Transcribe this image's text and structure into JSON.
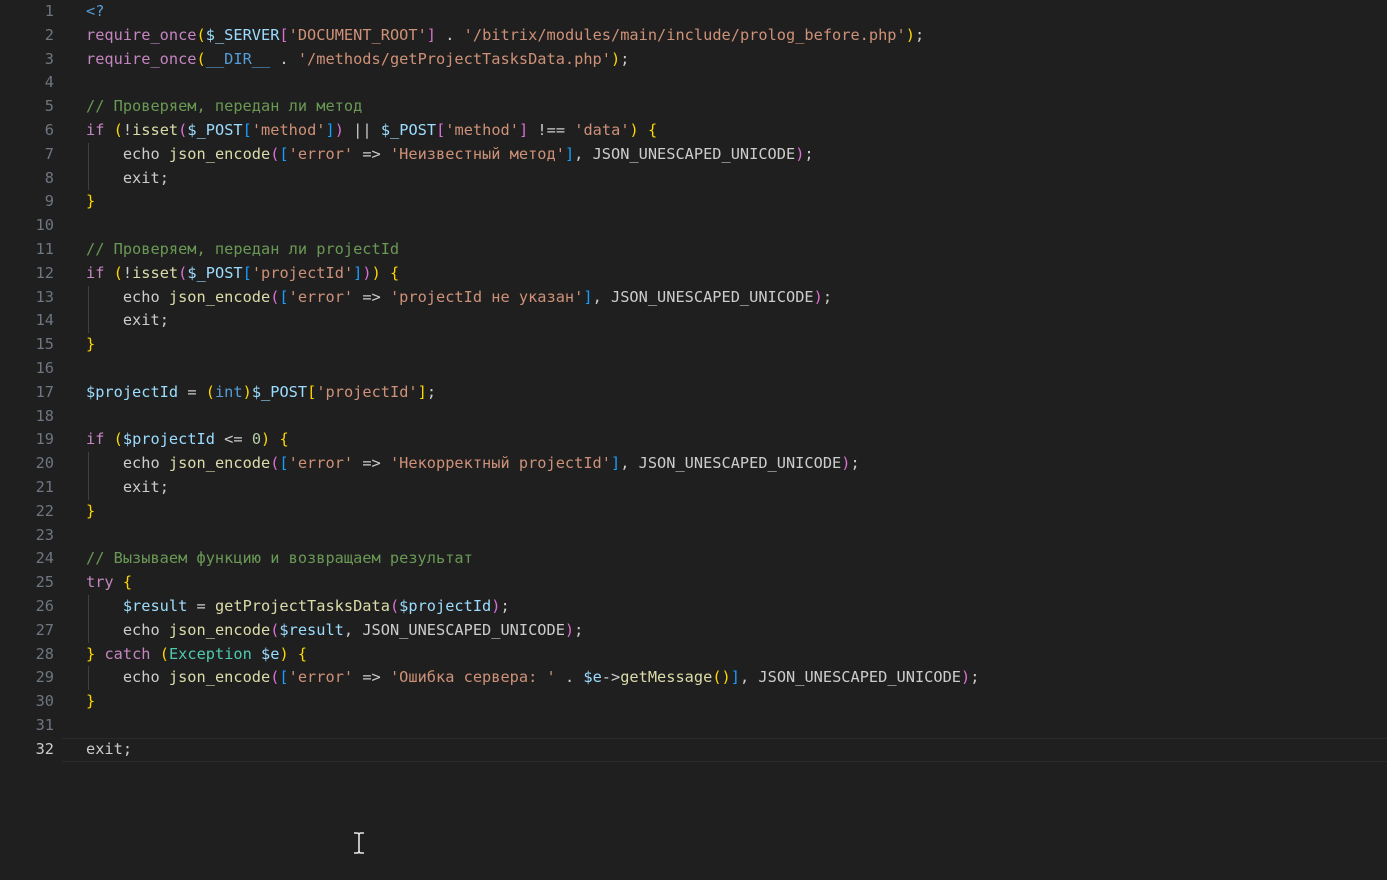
{
  "editor": {
    "language": "php",
    "current_line": 32,
    "colors": {
      "background": "#1f1f1f",
      "line_number": "#6e7681",
      "line_number_active": "#cccccc",
      "keyword": "#569cd6",
      "control": "#c586c0",
      "function": "#dcdcaa",
      "variable": "#9cdcfe",
      "string": "#ce9178",
      "comment": "#6a9955",
      "constant": "#4fc1ff",
      "type": "#4ec9b0",
      "number": "#b5cea8",
      "bracket1": "#ffd700",
      "bracket2": "#da70d6",
      "bracket3": "#179fff",
      "plain": "#cccccc"
    },
    "lines": [
      {
        "n": "1",
        "t": [
          [
            "<?",
            "keyword"
          ]
        ]
      },
      {
        "n": "2",
        "t": [
          [
            "require_once",
            "control"
          ],
          [
            "(",
            "bracket1"
          ],
          [
            "$_SERVER",
            "variable"
          ],
          [
            "[",
            "bracket2"
          ],
          [
            "'DOCUMENT_ROOT'",
            "string"
          ],
          [
            "]",
            "bracket2"
          ],
          [
            " . ",
            "plain"
          ],
          [
            "'/bitrix/modules/main/include/prolog_before.php'",
            "string"
          ],
          [
            ")",
            "bracket1"
          ],
          [
            ";",
            "plain"
          ]
        ]
      },
      {
        "n": "3",
        "t": [
          [
            "require_once",
            "control"
          ],
          [
            "(",
            "bracket1"
          ],
          [
            "__DIR__",
            "keyword"
          ],
          [
            " . ",
            "plain"
          ],
          [
            "'/methods/getProjectTasksData.php'",
            "string"
          ],
          [
            ")",
            "bracket1"
          ],
          [
            ";",
            "plain"
          ]
        ]
      },
      {
        "n": "4",
        "t": []
      },
      {
        "n": "5",
        "t": [
          [
            "// Проверяем, передан ли метод",
            "comment"
          ]
        ]
      },
      {
        "n": "6",
        "t": [
          [
            "if",
            "control"
          ],
          [
            " ",
            "plain"
          ],
          [
            "(",
            "bracket1"
          ],
          [
            "!",
            "plain"
          ],
          [
            "isset",
            "function"
          ],
          [
            "(",
            "bracket2"
          ],
          [
            "$_POST",
            "variable"
          ],
          [
            "[",
            "bracket3"
          ],
          [
            "'method'",
            "string"
          ],
          [
            "]",
            "bracket3"
          ],
          [
            ")",
            "bracket2"
          ],
          [
            " || ",
            "plain"
          ],
          [
            "$_POST",
            "variable"
          ],
          [
            "[",
            "bracket2"
          ],
          [
            "'method'",
            "string"
          ],
          [
            "]",
            "bracket2"
          ],
          [
            " !== ",
            "plain"
          ],
          [
            "'data'",
            "string"
          ],
          [
            ")",
            "bracket1"
          ],
          [
            " ",
            "plain"
          ],
          [
            "{",
            "bracket1"
          ]
        ]
      },
      {
        "n": "7",
        "t": [
          [
            "    echo ",
            "plain"
          ],
          [
            "json_encode",
            "function"
          ],
          [
            "(",
            "bracket2"
          ],
          [
            "[",
            "bracket3"
          ],
          [
            "'error'",
            "string"
          ],
          [
            " => ",
            "plain"
          ],
          [
            "'Неизвестный метод'",
            "string"
          ],
          [
            "]",
            "bracket3"
          ],
          [
            ", ",
            "plain"
          ],
          [
            "JSON_UNESCAPED_UNICODE",
            "plain"
          ],
          [
            ")",
            "bracket2"
          ],
          [
            ";",
            "plain"
          ]
        ]
      },
      {
        "n": "8",
        "t": [
          [
            "    exit",
            "plain"
          ],
          [
            ";",
            "plain"
          ]
        ]
      },
      {
        "n": "9",
        "t": [
          [
            "}",
            "bracket1"
          ]
        ]
      },
      {
        "n": "10",
        "t": []
      },
      {
        "n": "11",
        "t": [
          [
            "// Проверяем, передан ли projectId",
            "comment"
          ]
        ]
      },
      {
        "n": "12",
        "t": [
          [
            "if",
            "control"
          ],
          [
            " ",
            "plain"
          ],
          [
            "(",
            "bracket1"
          ],
          [
            "!",
            "plain"
          ],
          [
            "isset",
            "function"
          ],
          [
            "(",
            "bracket2"
          ],
          [
            "$_POST",
            "variable"
          ],
          [
            "[",
            "bracket3"
          ],
          [
            "'projectId'",
            "string"
          ],
          [
            "]",
            "bracket3"
          ],
          [
            ")",
            "bracket2"
          ],
          [
            ")",
            "bracket1"
          ],
          [
            " ",
            "plain"
          ],
          [
            "{",
            "bracket1"
          ]
        ]
      },
      {
        "n": "13",
        "t": [
          [
            "    echo ",
            "plain"
          ],
          [
            "json_encode",
            "function"
          ],
          [
            "(",
            "bracket2"
          ],
          [
            "[",
            "bracket3"
          ],
          [
            "'error'",
            "string"
          ],
          [
            " => ",
            "plain"
          ],
          [
            "'projectId не указан'",
            "string"
          ],
          [
            "]",
            "bracket3"
          ],
          [
            ", ",
            "plain"
          ],
          [
            "JSON_UNESCAPED_UNICODE",
            "plain"
          ],
          [
            ")",
            "bracket2"
          ],
          [
            ";",
            "plain"
          ]
        ]
      },
      {
        "n": "14",
        "t": [
          [
            "    exit",
            "plain"
          ],
          [
            ";",
            "plain"
          ]
        ]
      },
      {
        "n": "15",
        "t": [
          [
            "}",
            "bracket1"
          ]
        ]
      },
      {
        "n": "16",
        "t": []
      },
      {
        "n": "17",
        "t": [
          [
            "$projectId",
            "variable"
          ],
          [
            " = ",
            "plain"
          ],
          [
            "(",
            "bracket1"
          ],
          [
            "int",
            "keyword"
          ],
          [
            ")",
            "bracket1"
          ],
          [
            "$_POST",
            "variable"
          ],
          [
            "[",
            "bracket1"
          ],
          [
            "'projectId'",
            "string"
          ],
          [
            "]",
            "bracket1"
          ],
          [
            ";",
            "plain"
          ]
        ]
      },
      {
        "n": "18",
        "t": []
      },
      {
        "n": "19",
        "t": [
          [
            "if",
            "control"
          ],
          [
            " ",
            "plain"
          ],
          [
            "(",
            "bracket1"
          ],
          [
            "$projectId",
            "variable"
          ],
          [
            " <= ",
            "plain"
          ],
          [
            "0",
            "number"
          ],
          [
            ")",
            "bracket1"
          ],
          [
            " ",
            "plain"
          ],
          [
            "{",
            "bracket1"
          ]
        ]
      },
      {
        "n": "20",
        "t": [
          [
            "    echo ",
            "plain"
          ],
          [
            "json_encode",
            "function"
          ],
          [
            "(",
            "bracket2"
          ],
          [
            "[",
            "bracket3"
          ],
          [
            "'error'",
            "string"
          ],
          [
            " => ",
            "plain"
          ],
          [
            "'Некорректный projectId'",
            "string"
          ],
          [
            "]",
            "bracket3"
          ],
          [
            ", ",
            "plain"
          ],
          [
            "JSON_UNESCAPED_UNICODE",
            "plain"
          ],
          [
            ")",
            "bracket2"
          ],
          [
            ";",
            "plain"
          ]
        ]
      },
      {
        "n": "21",
        "t": [
          [
            "    exit",
            "plain"
          ],
          [
            ";",
            "plain"
          ]
        ]
      },
      {
        "n": "22",
        "t": [
          [
            "}",
            "bracket1"
          ]
        ]
      },
      {
        "n": "23",
        "t": []
      },
      {
        "n": "24",
        "t": [
          [
            "// Вызываем функцию и возвращаем результат",
            "comment"
          ]
        ]
      },
      {
        "n": "25",
        "t": [
          [
            "try",
            "control"
          ],
          [
            " ",
            "plain"
          ],
          [
            "{",
            "bracket1"
          ]
        ]
      },
      {
        "n": "26",
        "t": [
          [
            "    ",
            "plain"
          ],
          [
            "$result",
            "variable"
          ],
          [
            " = ",
            "plain"
          ],
          [
            "getProjectTasksData",
            "function"
          ],
          [
            "(",
            "bracket2"
          ],
          [
            "$projectId",
            "variable"
          ],
          [
            ")",
            "bracket2"
          ],
          [
            ";",
            "plain"
          ]
        ]
      },
      {
        "n": "27",
        "t": [
          [
            "    echo ",
            "plain"
          ],
          [
            "json_encode",
            "function"
          ],
          [
            "(",
            "bracket2"
          ],
          [
            "$result",
            "variable"
          ],
          [
            ", ",
            "plain"
          ],
          [
            "JSON_UNESCAPED_UNICODE",
            "plain"
          ],
          [
            ")",
            "bracket2"
          ],
          [
            ";",
            "plain"
          ]
        ]
      },
      {
        "n": "28",
        "t": [
          [
            "}",
            "bracket1"
          ],
          [
            " ",
            "plain"
          ],
          [
            "catch",
            "control"
          ],
          [
            " ",
            "plain"
          ],
          [
            "(",
            "bracket1"
          ],
          [
            "Exception",
            "type"
          ],
          [
            " ",
            "plain"
          ],
          [
            "$e",
            "variable"
          ],
          [
            ")",
            "bracket1"
          ],
          [
            " ",
            "plain"
          ],
          [
            "{",
            "bracket1"
          ]
        ]
      },
      {
        "n": "29",
        "t": [
          [
            "    echo ",
            "plain"
          ],
          [
            "json_encode",
            "function"
          ],
          [
            "(",
            "bracket2"
          ],
          [
            "[",
            "bracket3"
          ],
          [
            "'error'",
            "string"
          ],
          [
            " => ",
            "plain"
          ],
          [
            "'Ошибка сервера: '",
            "string"
          ],
          [
            " . ",
            "plain"
          ],
          [
            "$e",
            "variable"
          ],
          [
            "->",
            "plain"
          ],
          [
            "getMessage",
            "function"
          ],
          [
            "(",
            "bracket1"
          ],
          [
            ")",
            "bracket1"
          ],
          [
            "]",
            "bracket3"
          ],
          [
            ", ",
            "plain"
          ],
          [
            "JSON_UNESCAPED_UNICODE",
            "plain"
          ],
          [
            ")",
            "bracket2"
          ],
          [
            ";",
            "plain"
          ]
        ]
      },
      {
        "n": "30",
        "t": [
          [
            "}",
            "bracket1"
          ]
        ]
      },
      {
        "n": "31",
        "t": []
      },
      {
        "n": "32",
        "t": [
          [
            "exit",
            "plain"
          ],
          [
            ";",
            "plain"
          ]
        ]
      }
    ]
  },
  "cursor": {
    "icon": "text-cursor-icon"
  }
}
